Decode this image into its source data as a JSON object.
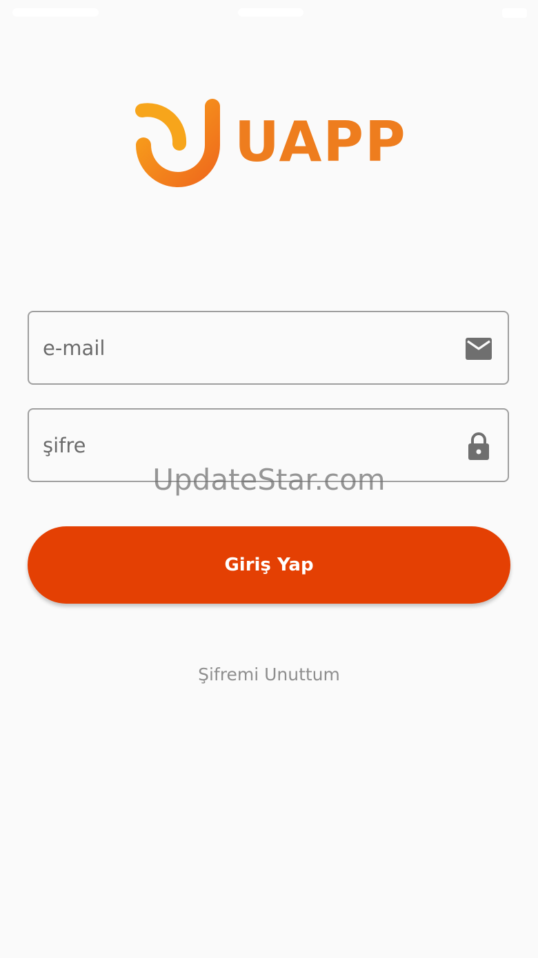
{
  "app": {
    "logo_text": "UAPP",
    "brand_color": "#ee7d1e"
  },
  "form": {
    "email": {
      "placeholder": "e-mail",
      "icon": "mail-icon"
    },
    "password": {
      "placeholder": "şifre",
      "icon": "lock-icon"
    },
    "submit_label": "Giriş Yap",
    "submit_color": "#e44003",
    "forgot_label": "Şifremi Unuttum"
  },
  "watermark": "UpdateStar.com"
}
